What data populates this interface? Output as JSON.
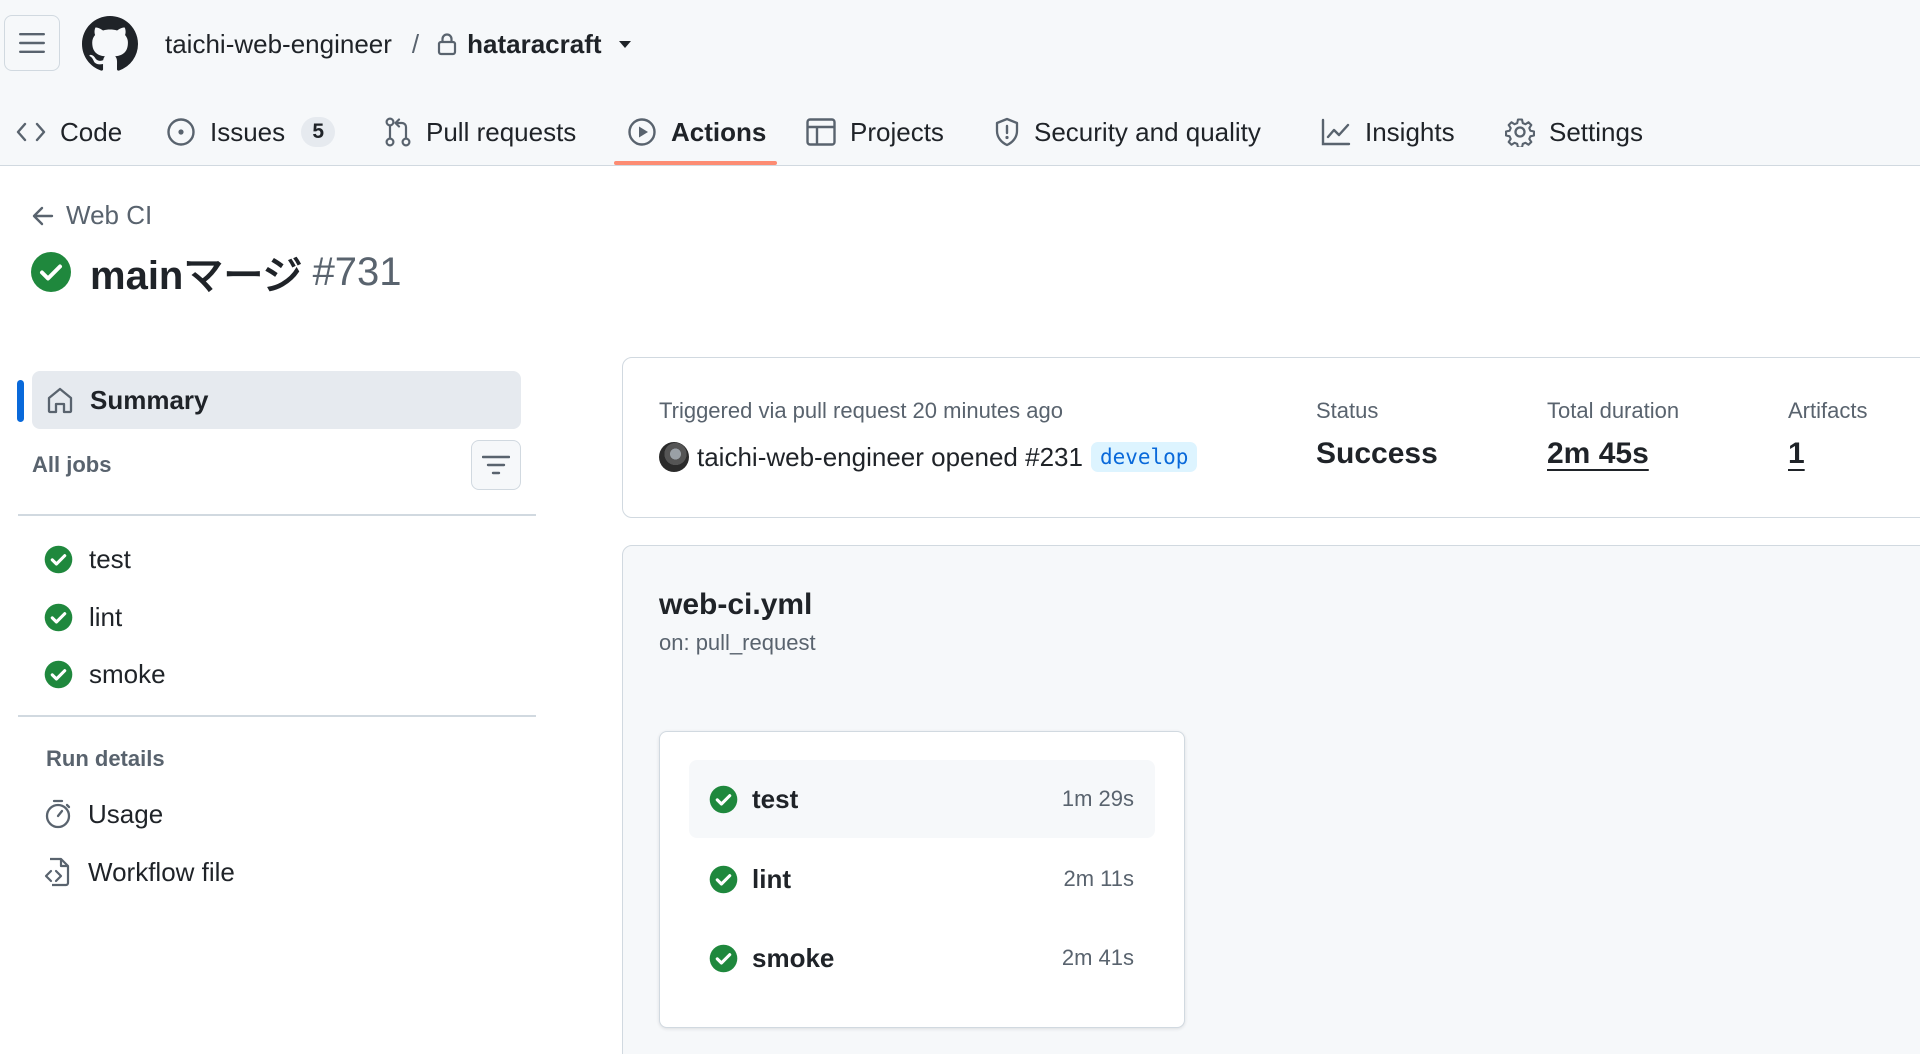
{
  "header": {
    "owner": "taichi-web-engineer",
    "separator": "/",
    "repo": "hataracraft",
    "icons": [
      "hamburger-icon",
      "github-logo",
      "lock-icon",
      "caret-down-icon"
    ]
  },
  "tabs": [
    {
      "label": "Code",
      "icon": "code-icon"
    },
    {
      "label": "Issues",
      "icon": "issue-opened-icon",
      "counter": "5"
    },
    {
      "label": "Pull requests",
      "icon": "git-pull-request-icon"
    },
    {
      "label": "Actions",
      "icon": "play-icon",
      "selected": true
    },
    {
      "label": "Projects",
      "icon": "table-icon"
    },
    {
      "label": "Security and quality",
      "icon": "shield-icon"
    },
    {
      "label": "Insights",
      "icon": "graph-icon"
    },
    {
      "label": "Settings",
      "icon": "gear-icon"
    }
  ],
  "run": {
    "back_label": "Web CI",
    "title": "mainマージ",
    "number": "#731",
    "status_icon": "check-circle-fill-icon"
  },
  "sidebar": {
    "summary_label": "Summary",
    "all_jobs_label": "All jobs",
    "jobs": [
      {
        "name": "test"
      },
      {
        "name": "lint"
      },
      {
        "name": "smoke"
      }
    ],
    "run_details_label": "Run details",
    "details": [
      {
        "label": "Usage",
        "icon": "stopwatch-icon"
      },
      {
        "label": "Workflow file",
        "icon": "file-code-icon"
      }
    ]
  },
  "summary_card": {
    "trigger_label": "Triggered via pull request 20 minutes ago",
    "trigger_text": "taichi-web-engineer opened #231",
    "branch": "develop",
    "status_label": "Status",
    "status_value": "Success",
    "duration_label": "Total duration",
    "duration_value": "2m 45s",
    "artifacts_label": "Artifacts",
    "artifacts_value": "1"
  },
  "workflow": {
    "file": "web-ci.yml",
    "trigger": "on: pull_request",
    "jobs": [
      {
        "name": "test",
        "duration": "1m 29s"
      },
      {
        "name": "lint",
        "duration": "2m 11s"
      },
      {
        "name": "smoke",
        "duration": "2m 41s"
      }
    ]
  },
  "colors": {
    "success": "#1f883d",
    "accent": "#0969da",
    "tab_underline": "#fd8c73"
  }
}
